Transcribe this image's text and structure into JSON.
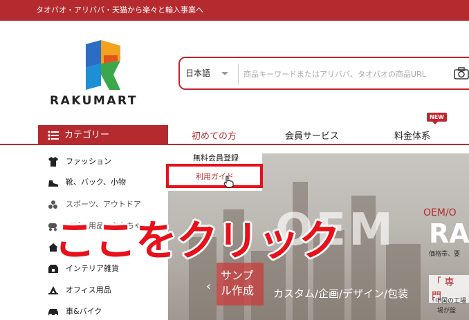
{
  "topbar": {
    "text": "タオバオ・アリババ・天猫から楽々と輸入事業へ"
  },
  "logo": {
    "text": "RAKUMART"
  },
  "search": {
    "lang": "日本語",
    "placeholder": "商品キーワードまたはアリババ、タオバオの商品URL"
  },
  "nav": {
    "category": "カテゴリー",
    "first_time": "初めての方",
    "member": "会員サービス",
    "pricing": "料金体系",
    "new_badge": "NEW"
  },
  "sidebar": {
    "items": [
      {
        "label": "ファッション",
        "icon": "shirt-icon"
      },
      {
        "label": "靴、バック、小物",
        "icon": "shoe-icon"
      },
      {
        "label": "スポーツ、アウトドア",
        "icon": "sports-icon"
      },
      {
        "label": "ベビー用品、おもちゃ",
        "icon": "baby-icon"
      },
      {
        "label": "",
        "icon": "home-icon"
      },
      {
        "label": "インテリア雑貨",
        "icon": "interior-icon"
      },
      {
        "label": "オフィス用品",
        "icon": "office-icon"
      },
      {
        "label": "車&バイク",
        "icon": "car-icon"
      }
    ]
  },
  "dropdown": {
    "item1": "無料会員登録",
    "item2": "利用ガイド"
  },
  "banner": {
    "oem": "OEM",
    "right_title": "OEM/O",
    "right_ra": "RA",
    "right_sub": "価格帯、要",
    "bracket": "「 専 門",
    "small1": "「中国の工場",
    "small2": "場が盤",
    "sample": "サンプル作成",
    "custom": "カスタム/企画/デザイン/包装"
  },
  "overlay": {
    "text": "ここをクリック"
  },
  "colors": {
    "brand_red": "#b52a2f",
    "highlight_red": "#e8101a"
  }
}
